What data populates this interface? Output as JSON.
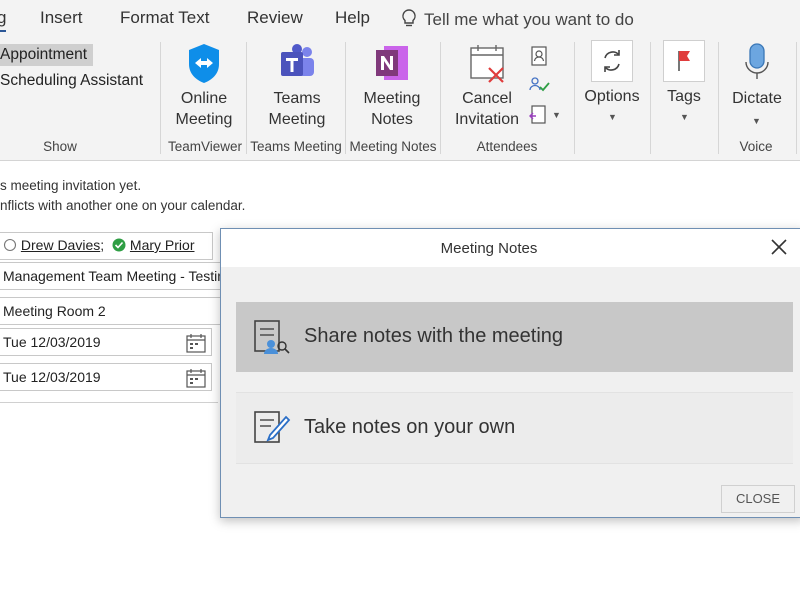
{
  "tabs": [
    {
      "label": "g",
      "active": true
    },
    {
      "label": "Insert"
    },
    {
      "label": "Format Text"
    },
    {
      "label": "Review"
    },
    {
      "label": "Help"
    }
  ],
  "tell_me": "Tell me what you want to do",
  "ribbon": {
    "show": {
      "items": [
        "Appointment",
        "Scheduling Assistant"
      ],
      "label": "Show"
    },
    "teamviewer": {
      "button": "Online\nMeeting",
      "label": "TeamViewer"
    },
    "teams": {
      "button": "Teams\nMeeting",
      "label": "Teams Meeting"
    },
    "notes": {
      "button": "Meeting\nNotes",
      "label": "Meeting Notes"
    },
    "attendees": {
      "button": "Cancel\nInvitation",
      "label": "Attendees"
    },
    "options": {
      "button": "Options"
    },
    "tags": {
      "button": "Tags"
    },
    "voice": {
      "button": "Dictate",
      "label": "Voice"
    }
  },
  "info": {
    "line1": "s meeting invitation yet.",
    "line2": "nflicts with another one on your calendar."
  },
  "form": {
    "attendee1": "Drew Davies",
    "attendee_sep": ";",
    "attendee2": "Mary Prior",
    "subject": "Management Team Meeting - Testin",
    "location": "Meeting Room 2",
    "start_date": "Tue 12/03/2019",
    "end_date": "Tue 12/03/2019"
  },
  "dialog": {
    "title": "Meeting Notes",
    "option1": "Share notes with the meeting",
    "option2": "Take notes on your own",
    "close": "CLOSE"
  },
  "colors": {
    "teams_purple": "#5059c9",
    "onenote_purple": "#80397b",
    "teamviewer_blue": "#0e8ee9",
    "accent": "#2b5797"
  }
}
